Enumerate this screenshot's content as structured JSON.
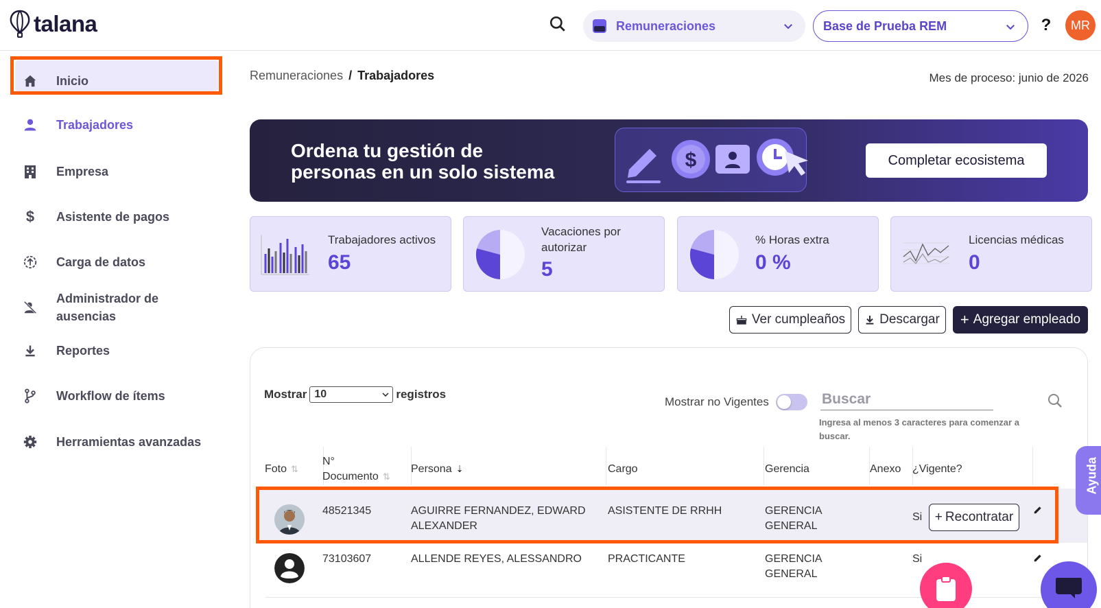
{
  "header": {
    "logo_text": "talana",
    "module": "Remuneraciones",
    "base": "Base de Prueba REM",
    "help": "?",
    "avatar_initials": "MR"
  },
  "sidebar": {
    "items": [
      {
        "label": "Inicio",
        "icon": "home-icon"
      },
      {
        "label": "Trabajadores",
        "icon": "person-icon",
        "active": true
      },
      {
        "label": "Empresa",
        "icon": "building-icon"
      },
      {
        "label": "Asistente de pagos",
        "icon": "dollar-icon"
      },
      {
        "label": "Carga de datos",
        "icon": "upload-icon"
      },
      {
        "label": "Administrador de ausencias",
        "icon": "person-off-icon"
      },
      {
        "label": "Reportes",
        "icon": "download-icon"
      },
      {
        "label": "Workflow de ítems",
        "icon": "branch-icon"
      },
      {
        "label": "Herramientas avanzadas",
        "icon": "gear-icon"
      }
    ]
  },
  "breadcrumb": {
    "parent": "Remuneraciones",
    "separator": "/",
    "current": "Trabajadores"
  },
  "mes_proceso": "Mes de proceso: junio de 2026",
  "banner": {
    "title_line1": "Ordena tu gestión de",
    "title_line2": "personas en un solo sistema",
    "button": "Completar ecosistema"
  },
  "stats": [
    {
      "label": "Trabajadores activos",
      "value": "65",
      "icon": "bar-chart-icon"
    },
    {
      "label": "Vacaciones por autorizar",
      "value": "5",
      "icon": "pie-chart-icon"
    },
    {
      "label": "% Horas extra",
      "value": "0 %",
      "icon": "pie-chart-icon"
    },
    {
      "label": "Licencias médicas",
      "value": "0",
      "icon": "line-chart-icon"
    }
  ],
  "actions": {
    "birthdays": "Ver cumpleaños",
    "download": "Descargar",
    "add": "Agregar empleado"
  },
  "table_controls": {
    "show_label": "Mostrar",
    "page_size": "10",
    "records_label": "registros",
    "no_vigentes": "Mostrar no Vigentes",
    "search_placeholder": "Buscar",
    "search_hint": "Ingresa al menos 3 caracteres para comenzar a buscar."
  },
  "table": {
    "headers": {
      "foto": "Foto",
      "documento_line1": "N°",
      "documento_line2": "Documento",
      "persona": "Persona",
      "cargo": "Cargo",
      "gerencia": "Gerencia",
      "anexo": "Anexo",
      "vigente": "¿Vigente?"
    },
    "rows": [
      {
        "documento": "48521345",
        "persona_line1": "AGUIRRE FERNANDEZ, EDWARD",
        "persona_line2": "ALEXANDER",
        "cargo": "ASISTENTE DE RRHH",
        "gerencia_line1": "GERENCIA",
        "gerencia_line2": "GENERAL",
        "vigente": "Si",
        "action": "Recontratar"
      },
      {
        "documento": "73103607",
        "persona_line1": "ALLENDE REYES, ALESSANDRO",
        "persona_line2": "",
        "cargo": "PRACTICANTE",
        "gerencia_line1": "GERENCIA",
        "gerencia_line2": "GENERAL",
        "vigente": "Si"
      }
    ]
  },
  "ayuda": "Ayuda",
  "colors": {
    "primary": "#6c57d8",
    "dark": "#24213f",
    "highlight": "#ff5a0a",
    "avatar": "#f0622c"
  }
}
